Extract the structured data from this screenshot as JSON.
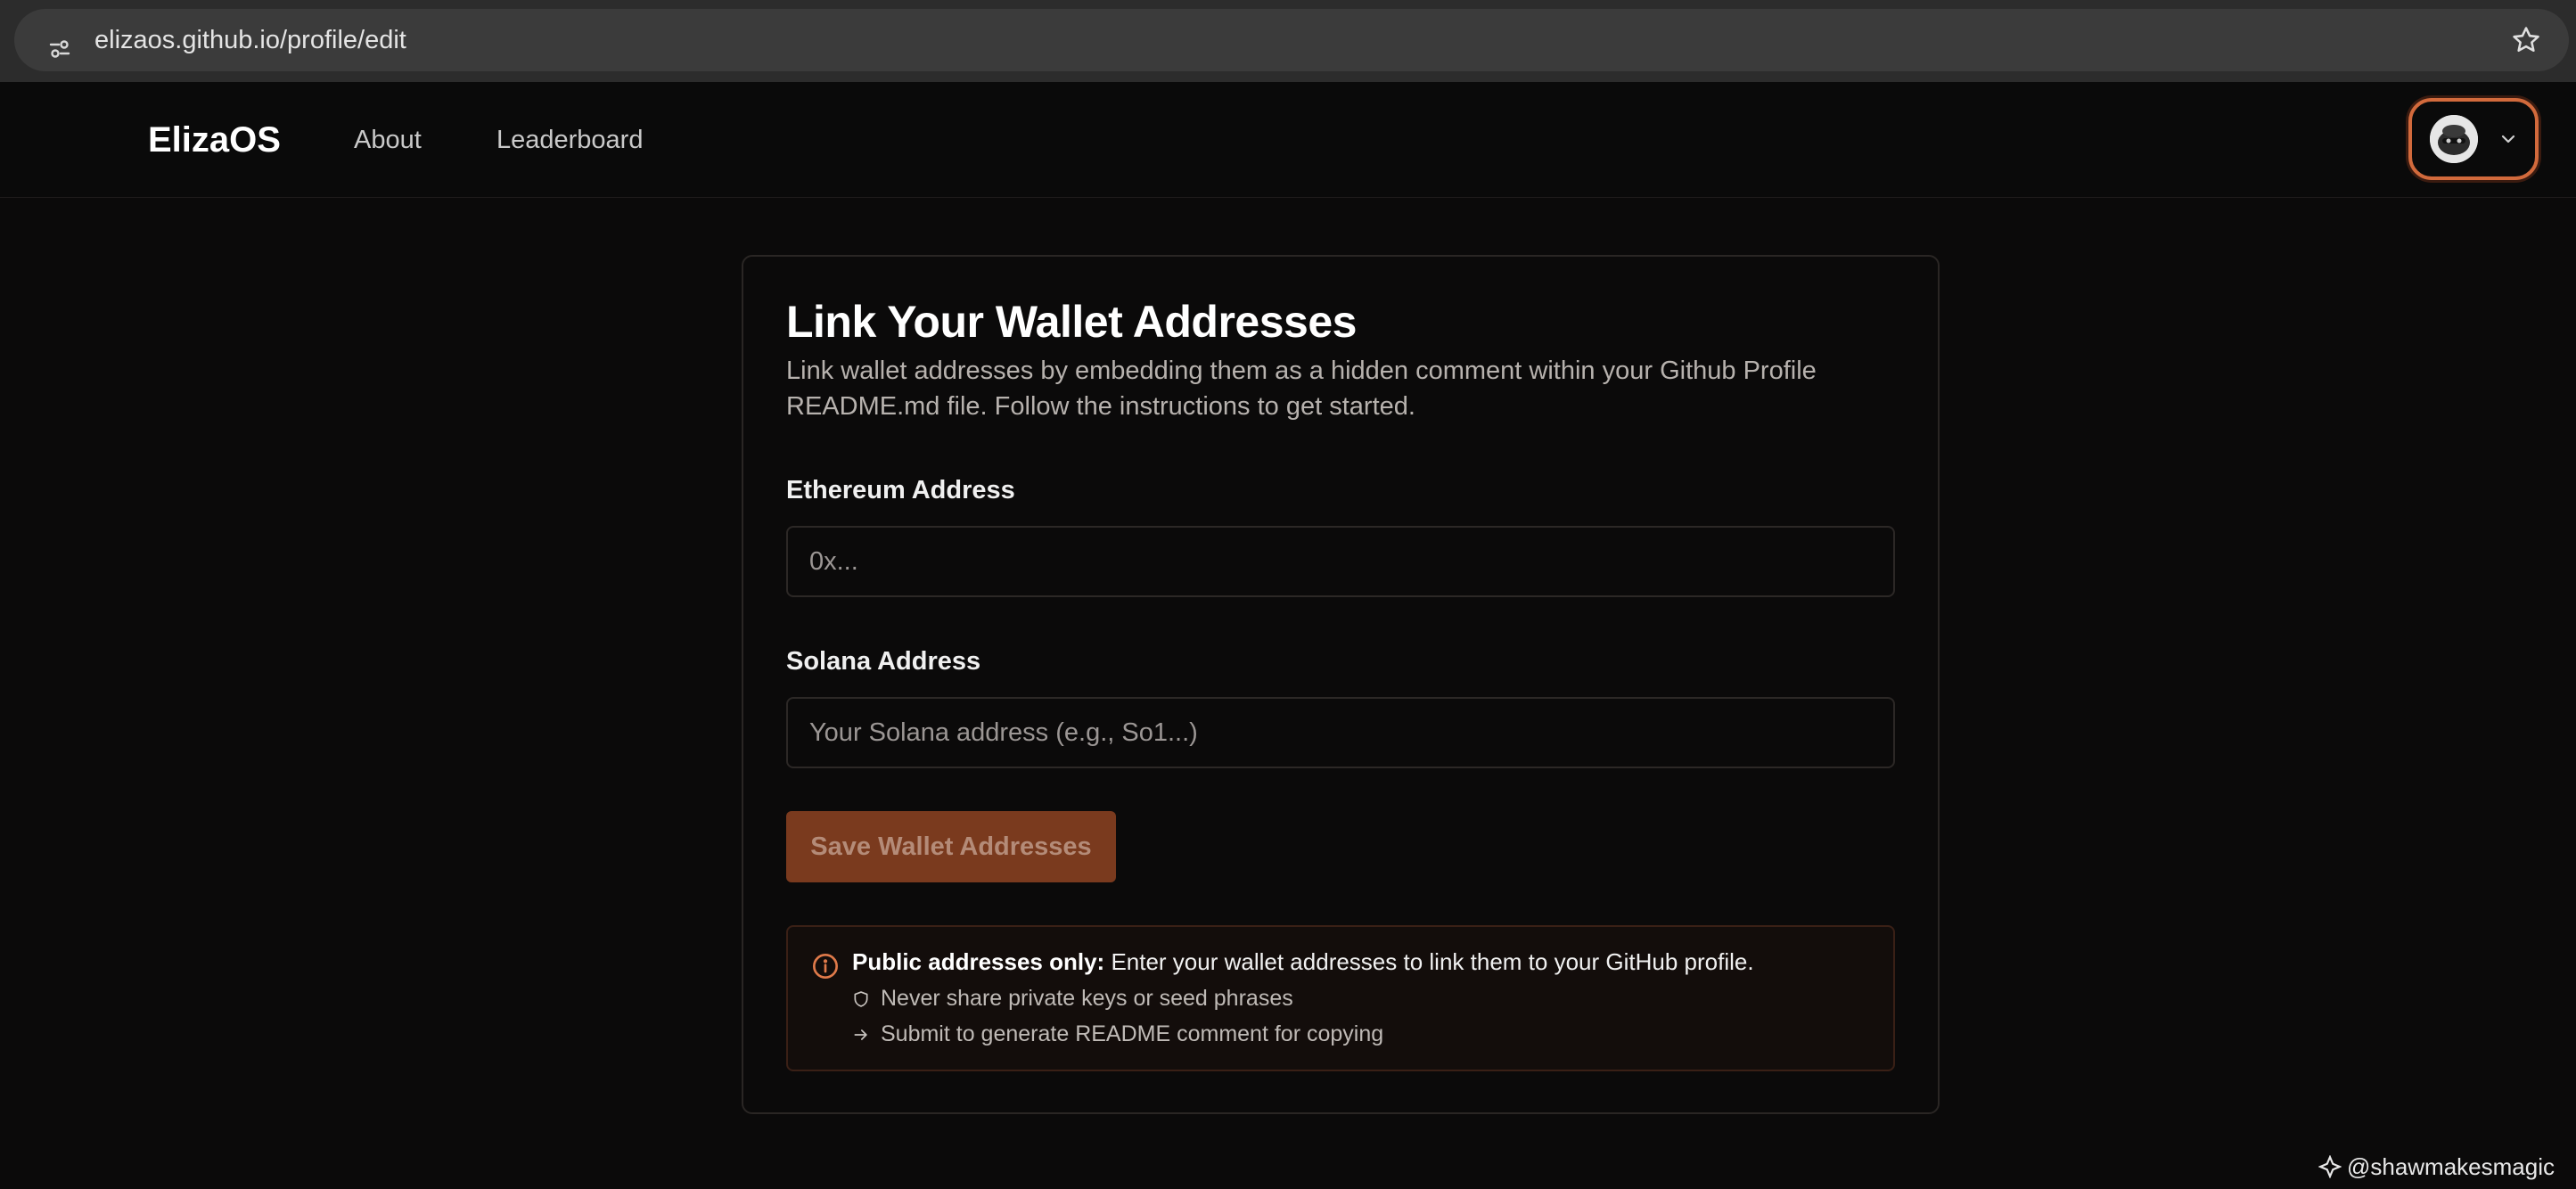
{
  "browser": {
    "url": "elizaos.github.io/profile/edit",
    "site_info_icon": "tune-icon",
    "bookmark_icon": "star-icon"
  },
  "header": {
    "logo": "ElizaOS",
    "nav": [
      {
        "label": "About"
      },
      {
        "label": "Leaderboard"
      }
    ],
    "profile_icon": "avatar",
    "menu_icon": "chevron-down-icon",
    "accent_color": "#d26a3c"
  },
  "card": {
    "title": "Link Your Wallet Addresses",
    "description": "Link wallet addresses by embedding them as a hidden comment within your Github Profile README.md file. Follow the instructions to get started.",
    "ethereum": {
      "label": "Ethereum Address",
      "value": "",
      "placeholder": "0x..."
    },
    "solana": {
      "label": "Solana Address",
      "value": "",
      "placeholder": "Your Solana address (e.g., So1...)"
    },
    "save_button": "Save Wallet Addresses",
    "notice": {
      "icon": "info-icon",
      "bold": "Public addresses only:",
      "text": " Enter your wallet addresses to link them to your GitHub profile.",
      "items": [
        {
          "icon": "shield-icon",
          "text": "Never share private keys or seed phrases"
        },
        {
          "icon": "arrow-right-icon",
          "text": "Submit to generate README comment for copying"
        }
      ]
    }
  },
  "watermark": "@shawmakesmagic"
}
